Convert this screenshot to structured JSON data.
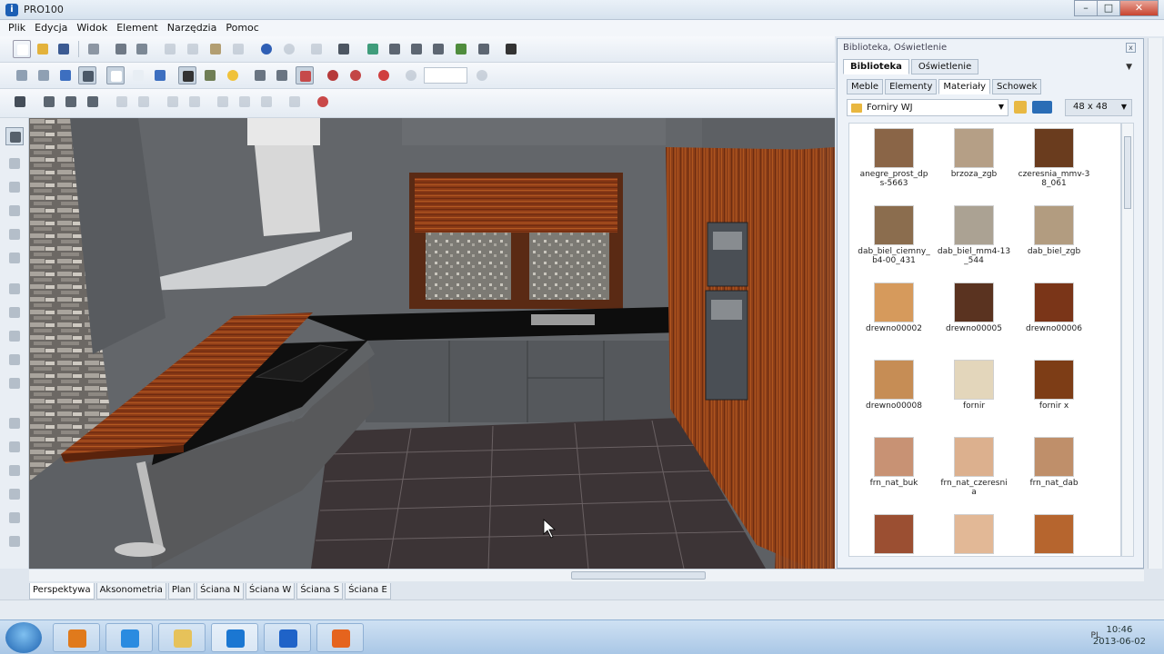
{
  "window": {
    "title": "PRO100"
  },
  "menu": [
    "Plik",
    "Edycja",
    "Widok",
    "Element",
    "Narzędzia",
    "Pomoc"
  ],
  "toolbar_icons": {
    "row1": [
      "new-file-icon",
      "open-file-icon",
      "save-icon",
      "export-icon",
      "print-icon",
      "print-preview-icon",
      "cut-icon",
      "copy-icon",
      "paste-icon",
      "delete-icon",
      "globe-icon",
      "render-icon",
      "settings-icon",
      "window-icon",
      "layout-icon",
      "layout-2-icon",
      "layout-3-icon",
      "layout-4-icon",
      "table-icon",
      "sum-icon"
    ],
    "row2": [
      "front-view-icon",
      "top-view-icon",
      "side-view-icon",
      "view-3d-icon",
      "box-icon",
      "box-shaded-icon",
      "box-blue-icon",
      "select-mode-icon",
      "paint-icon",
      "light-bulb-icon",
      "rotate-icon",
      "measure-icon",
      "grid-icon",
      "magnet-icon",
      "snap-icon",
      "target-icon",
      "zoom-out-icon",
      "zoom-in-icon"
    ],
    "row3": [
      "align-icon",
      "move-up-icon",
      "move-icon",
      "group-icon",
      "ungroup-icon",
      "arrow-down-icon",
      "undo-icon",
      "cross-move-icon",
      "arrow-up-icon",
      "mirror-icon",
      "target-red-icon"
    ]
  },
  "view_tabs": [
    "Perspektywa",
    "Aksonometria",
    "Plan",
    "Ściana N",
    "Ściana W",
    "Ściana S",
    "Ściana E"
  ],
  "active_view_tab": "Perspektywa",
  "library": {
    "panel_title": "Biblioteka, Oświetlenie",
    "main_tabs": [
      "Biblioteka",
      "Oświetlenie"
    ],
    "sub_tabs": [
      "Meble",
      "Elementy",
      "Materiały",
      "Schowek"
    ],
    "folder": "Forniry WJ",
    "thumb_size": "48 x 48",
    "materials": [
      {
        "name": "anegre_prost_dp\ns-5663",
        "color": "#8a6547"
      },
      {
        "name": "brzoza_zgb",
        "color": "#b59f86"
      },
      {
        "name": "czeresnia_mmv-3\n8_061",
        "color": "#6a3c1e"
      },
      {
        "name": "dab_biel_ciemny_\nb4-00_431",
        "color": "#8b6d4e"
      },
      {
        "name": "dab_biel_mm4-13\n_544",
        "color": "#aba293"
      },
      {
        "name": "dab_biel_zgb",
        "color": "#b29c80"
      },
      {
        "name": "drewno00002",
        "color": "#d69a5c"
      },
      {
        "name": "drewno00005",
        "color": "#5a3320"
      },
      {
        "name": "drewno00006",
        "color": "#7a3518"
      },
      {
        "name": "drewno00008",
        "color": "#c68d55"
      },
      {
        "name": "fornir",
        "color": "#e3d6bb"
      },
      {
        "name": "fornir x",
        "color": "#7d3d16"
      },
      {
        "name": "frn_nat_buk",
        "color": "#c89274"
      },
      {
        "name": "frn_nat_czeresni\na",
        "color": "#dcb08e"
      },
      {
        "name": "frn_nat_dab",
        "color": "#bf8f6a"
      },
      {
        "name": "",
        "color": "#9b4f32"
      },
      {
        "name": "",
        "color": "#e2b896"
      },
      {
        "name": "",
        "color": "#b6652e"
      }
    ]
  },
  "clock": {
    "time": "10:46",
    "date": "2013-06-02"
  },
  "tray": {
    "lang": "PL"
  },
  "taskbar_apps": [
    {
      "icon": "media-player-icon",
      "color": "#e07a1c"
    },
    {
      "icon": "internet-explorer-icon",
      "color": "#2a8be0"
    },
    {
      "icon": "folder-icon",
      "color": "#e6c25a"
    },
    {
      "icon": "bc-app-icon",
      "color": "#1b77d2"
    },
    {
      "icon": "upload-app-icon",
      "color": "#1f63c8"
    },
    {
      "icon": "firefox-icon",
      "color": "#e5641e"
    }
  ]
}
